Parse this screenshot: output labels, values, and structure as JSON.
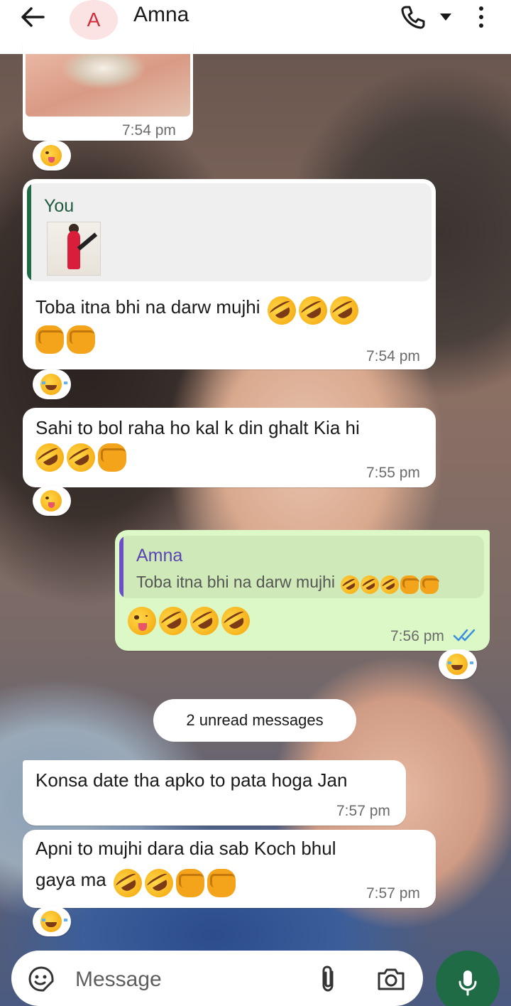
{
  "header": {
    "avatar_letter": "A",
    "contact_name": "Amna",
    "back_icon": "arrow-left-icon",
    "call_icon": "phone-icon",
    "call_dropdown_icon": "caret-down-icon",
    "more_icon": "vertical-dots-icon"
  },
  "messages": [
    {
      "id": "m0",
      "type": "image",
      "direction": "in",
      "time": "7:54 pm",
      "reaction": "winking-tongue-face"
    },
    {
      "id": "m1",
      "type": "text",
      "direction": "in",
      "quote": {
        "sender": "You",
        "kind": "photo"
      },
      "text": "Toba itna bhi na darw mujhi",
      "emojis": [
        "rofl",
        "rofl",
        "rofl",
        "fist",
        "fist"
      ],
      "time": "7:54 pm",
      "reaction": "tears-of-joy"
    },
    {
      "id": "m2",
      "type": "text",
      "direction": "in",
      "text": "Sahi to bol raha ho kal k din ghalt Kia hi",
      "emojis": [
        "rofl",
        "rofl",
        "fist"
      ],
      "time": "7:55 pm",
      "reaction": "winking-tongue-face"
    },
    {
      "id": "m3",
      "type": "text",
      "direction": "out",
      "quote": {
        "sender": "Amna",
        "text": "Toba itna bhi na darw mujhi",
        "emojis": [
          "rofl",
          "rofl",
          "rofl",
          "fist",
          "fist"
        ]
      },
      "emojis": [
        "winking-tongue-face",
        "rofl",
        "rofl",
        "rofl"
      ],
      "time": "7:56 pm",
      "status": "read",
      "reaction": "tears-of-joy"
    },
    {
      "id": "m4",
      "type": "text",
      "direction": "in",
      "text": "Konsa date tha apko to pata hoga Jan",
      "time": "7:57 pm"
    },
    {
      "id": "m5",
      "type": "text",
      "direction": "in",
      "text_line1": "Apni to mujhi dara dia sab Koch bhul",
      "text_line2": "gaya ma",
      "emojis": [
        "rofl",
        "rofl",
        "fist",
        "fist"
      ],
      "time": "7:57 pm",
      "reaction": "tears-of-joy"
    }
  ],
  "unread_banner": "2 unread messages",
  "composer": {
    "placeholder": "Message",
    "sticker_icon": "sticker-icon",
    "attach_icon": "paperclip-icon",
    "camera_icon": "camera-icon",
    "mic_icon": "microphone-icon"
  },
  "colors": {
    "header_bg": "#ffffff",
    "incoming_bubble": "#ffffff",
    "outgoing_bubble": "#dcf8c6",
    "quote_you_bar": "#1f6b45",
    "quote_amna_bar": "#6a4fc9",
    "read_ticks": "#3b8fe0",
    "mic_button": "#1f6b45",
    "avatar_bg": "#fbe3e3",
    "avatar_letter": "#d12c3c"
  }
}
